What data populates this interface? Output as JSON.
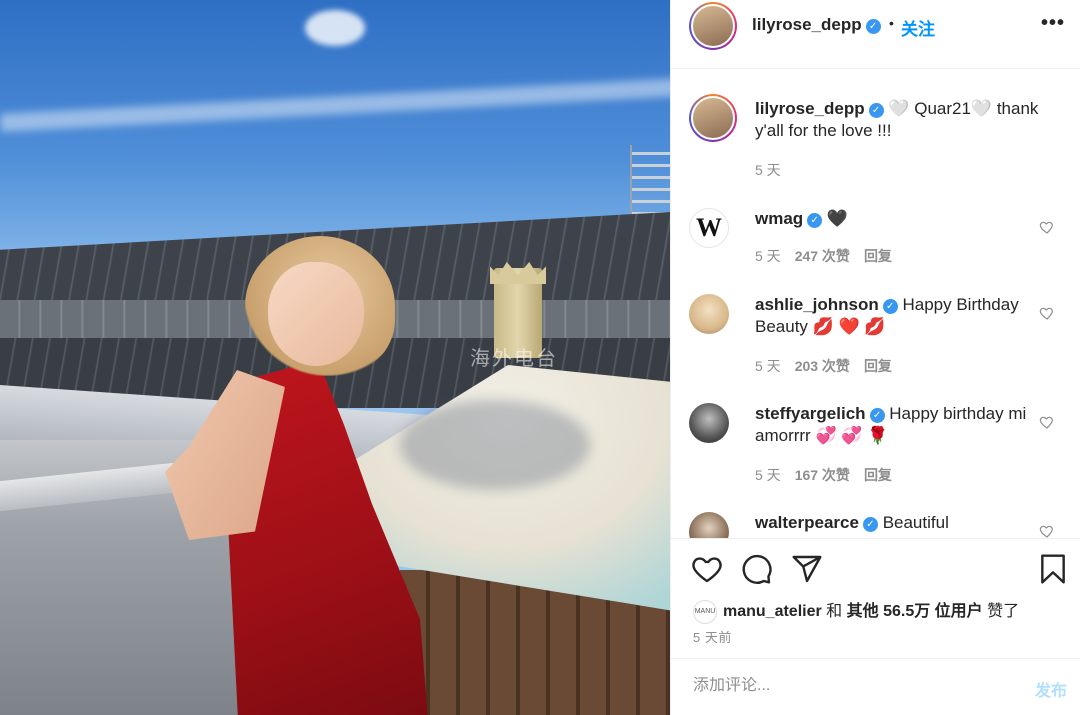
{
  "post": {
    "photo_alt": "woman in red dress on a rooftop",
    "watermark": "海外电台"
  },
  "header": {
    "username": "lilyrose_depp",
    "separator": "•",
    "follow_label": "关注",
    "more_label": "•••"
  },
  "caption": {
    "username": "lilyrose_depp",
    "text": "🤍 Quar21🤍  thank y'all for the love !!!",
    "time": "5 天"
  },
  "comments": [
    {
      "username": "wmag",
      "text": "🖤",
      "time": "5 天",
      "likes": "247 次赞",
      "reply": "回复",
      "avatar_letter": "W"
    },
    {
      "username": "ashlie_johnson",
      "text": "Happy Birthday Beauty 💋 ❤️ 💋",
      "time": "5 天",
      "likes": "203 次赞",
      "reply": "回复"
    },
    {
      "username": "steffyargelich",
      "text": "Happy birthday mi amorrrr 💞 💞 🌹",
      "time": "5 天",
      "likes": "167 次赞",
      "reply": "回复"
    },
    {
      "username": "walterpearce",
      "text": "Beautiful"
    }
  ],
  "actions": {
    "like_icon": "heart-icon",
    "comment_icon": "comment-icon",
    "share_icon": "send-icon",
    "save_icon": "bookmark-icon"
  },
  "likes": {
    "avatar_label": "MANU",
    "user": "manu_atelier",
    "connector": " 和 ",
    "others": "其他 56.5万 位用户",
    "suffix": " 赞了"
  },
  "posted_time": "5 天前",
  "add_comment": {
    "placeholder": "添加评论...",
    "post_label": "发布"
  },
  "colors": {
    "accent": "#0095f6",
    "verified": "#3897f0",
    "muted": "#8e8e8e",
    "post_disabled": "#b2dffc"
  }
}
